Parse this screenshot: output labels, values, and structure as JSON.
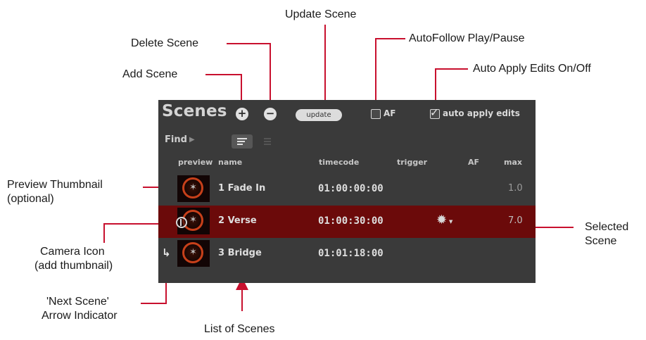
{
  "callouts": {
    "update_scene": "Update Scene",
    "delete_scene": "Delete Scene",
    "autofollow": "AutoFollow Play/Pause",
    "add_scene": "Add Scene",
    "auto_apply": "Auto Apply Edits On/Off",
    "preview_thumbnail_1": "Preview Thumbnail",
    "preview_thumbnail_2": "(optional)",
    "camera_icon_1": "Camera Icon",
    "camera_icon_2": "(add thumbnail)",
    "next_scene_1": "'Next Scene'",
    "next_scene_2": "Arrow Indicator",
    "list_of_scenes": "List of Scenes",
    "selected_scene_1": "Selected",
    "selected_scene_2": "Scene"
  },
  "panel": {
    "title": "Scenes",
    "add_symbol": "+",
    "delete_symbol": "−",
    "update_label": "update",
    "af_label": "AF",
    "af_checked": false,
    "auto_apply_label": "auto apply edits",
    "auto_apply_checked": true,
    "find_label": "Find",
    "columns": {
      "preview": "preview",
      "name": "name",
      "timecode": "timecode",
      "trigger": "trigger",
      "af": "AF",
      "max": "max"
    },
    "scenes": [
      {
        "name": "1 Fade In",
        "timecode": "01:00:00:00",
        "max": "1.0",
        "selected": false
      },
      {
        "name": "2 Verse",
        "timecode": "01:00:30:00",
        "max": "7.0",
        "selected": true,
        "trigger_icon": "gear-icon"
      },
      {
        "name": "3 Bridge",
        "timecode": "01:01:18:00",
        "max": "",
        "selected": false,
        "next_scene": true
      }
    ]
  },
  "colors": {
    "panel_bg": "#3a3a3a",
    "selected_row": "#6b0a0a",
    "callout_line": "#c8102e"
  }
}
